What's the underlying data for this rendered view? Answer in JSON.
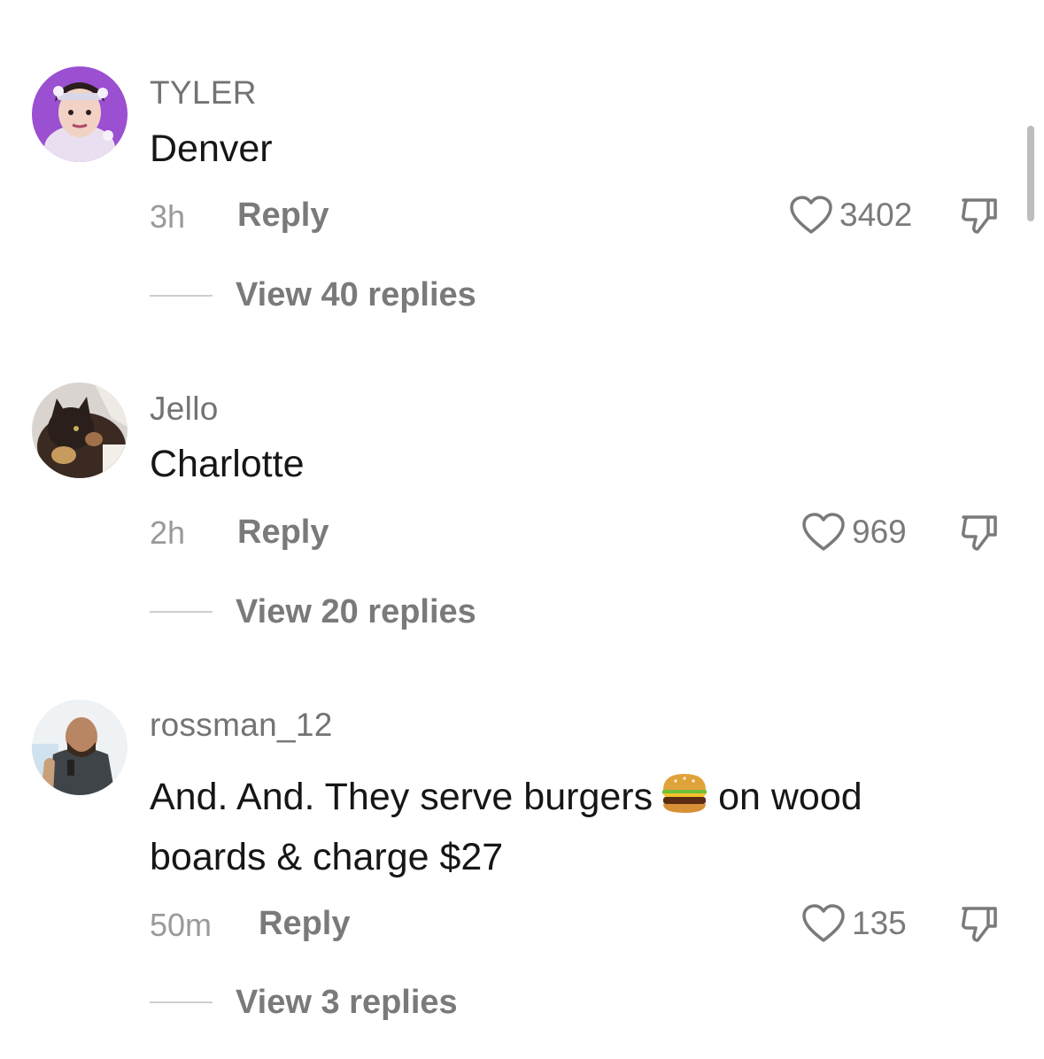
{
  "comments": [
    {
      "username": "TYLER",
      "text": "Denver",
      "time": "3h",
      "reply_label": "Reply",
      "likes": "3402",
      "view_replies": "View 40 replies"
    },
    {
      "username": "Jello",
      "text": "Charlotte",
      "time": "2h",
      "reply_label": "Reply",
      "likes": "969",
      "view_replies": "View 20 replies"
    },
    {
      "username": "rossman_12",
      "text_part1": "And. And. They serve burgers",
      "emoji": "burger-icon",
      "text_part2": "on wood boards & charge $27",
      "time": "50m",
      "reply_label": "Reply",
      "likes": "135",
      "view_replies": "View 3 replies"
    }
  ],
  "icons": {
    "like": "heart-outline-icon",
    "dislike": "thumbs-down-icon"
  },
  "colors": {
    "background": "#ffffff",
    "text_primary": "#161616",
    "text_secondary": "#7a7a7a"
  }
}
